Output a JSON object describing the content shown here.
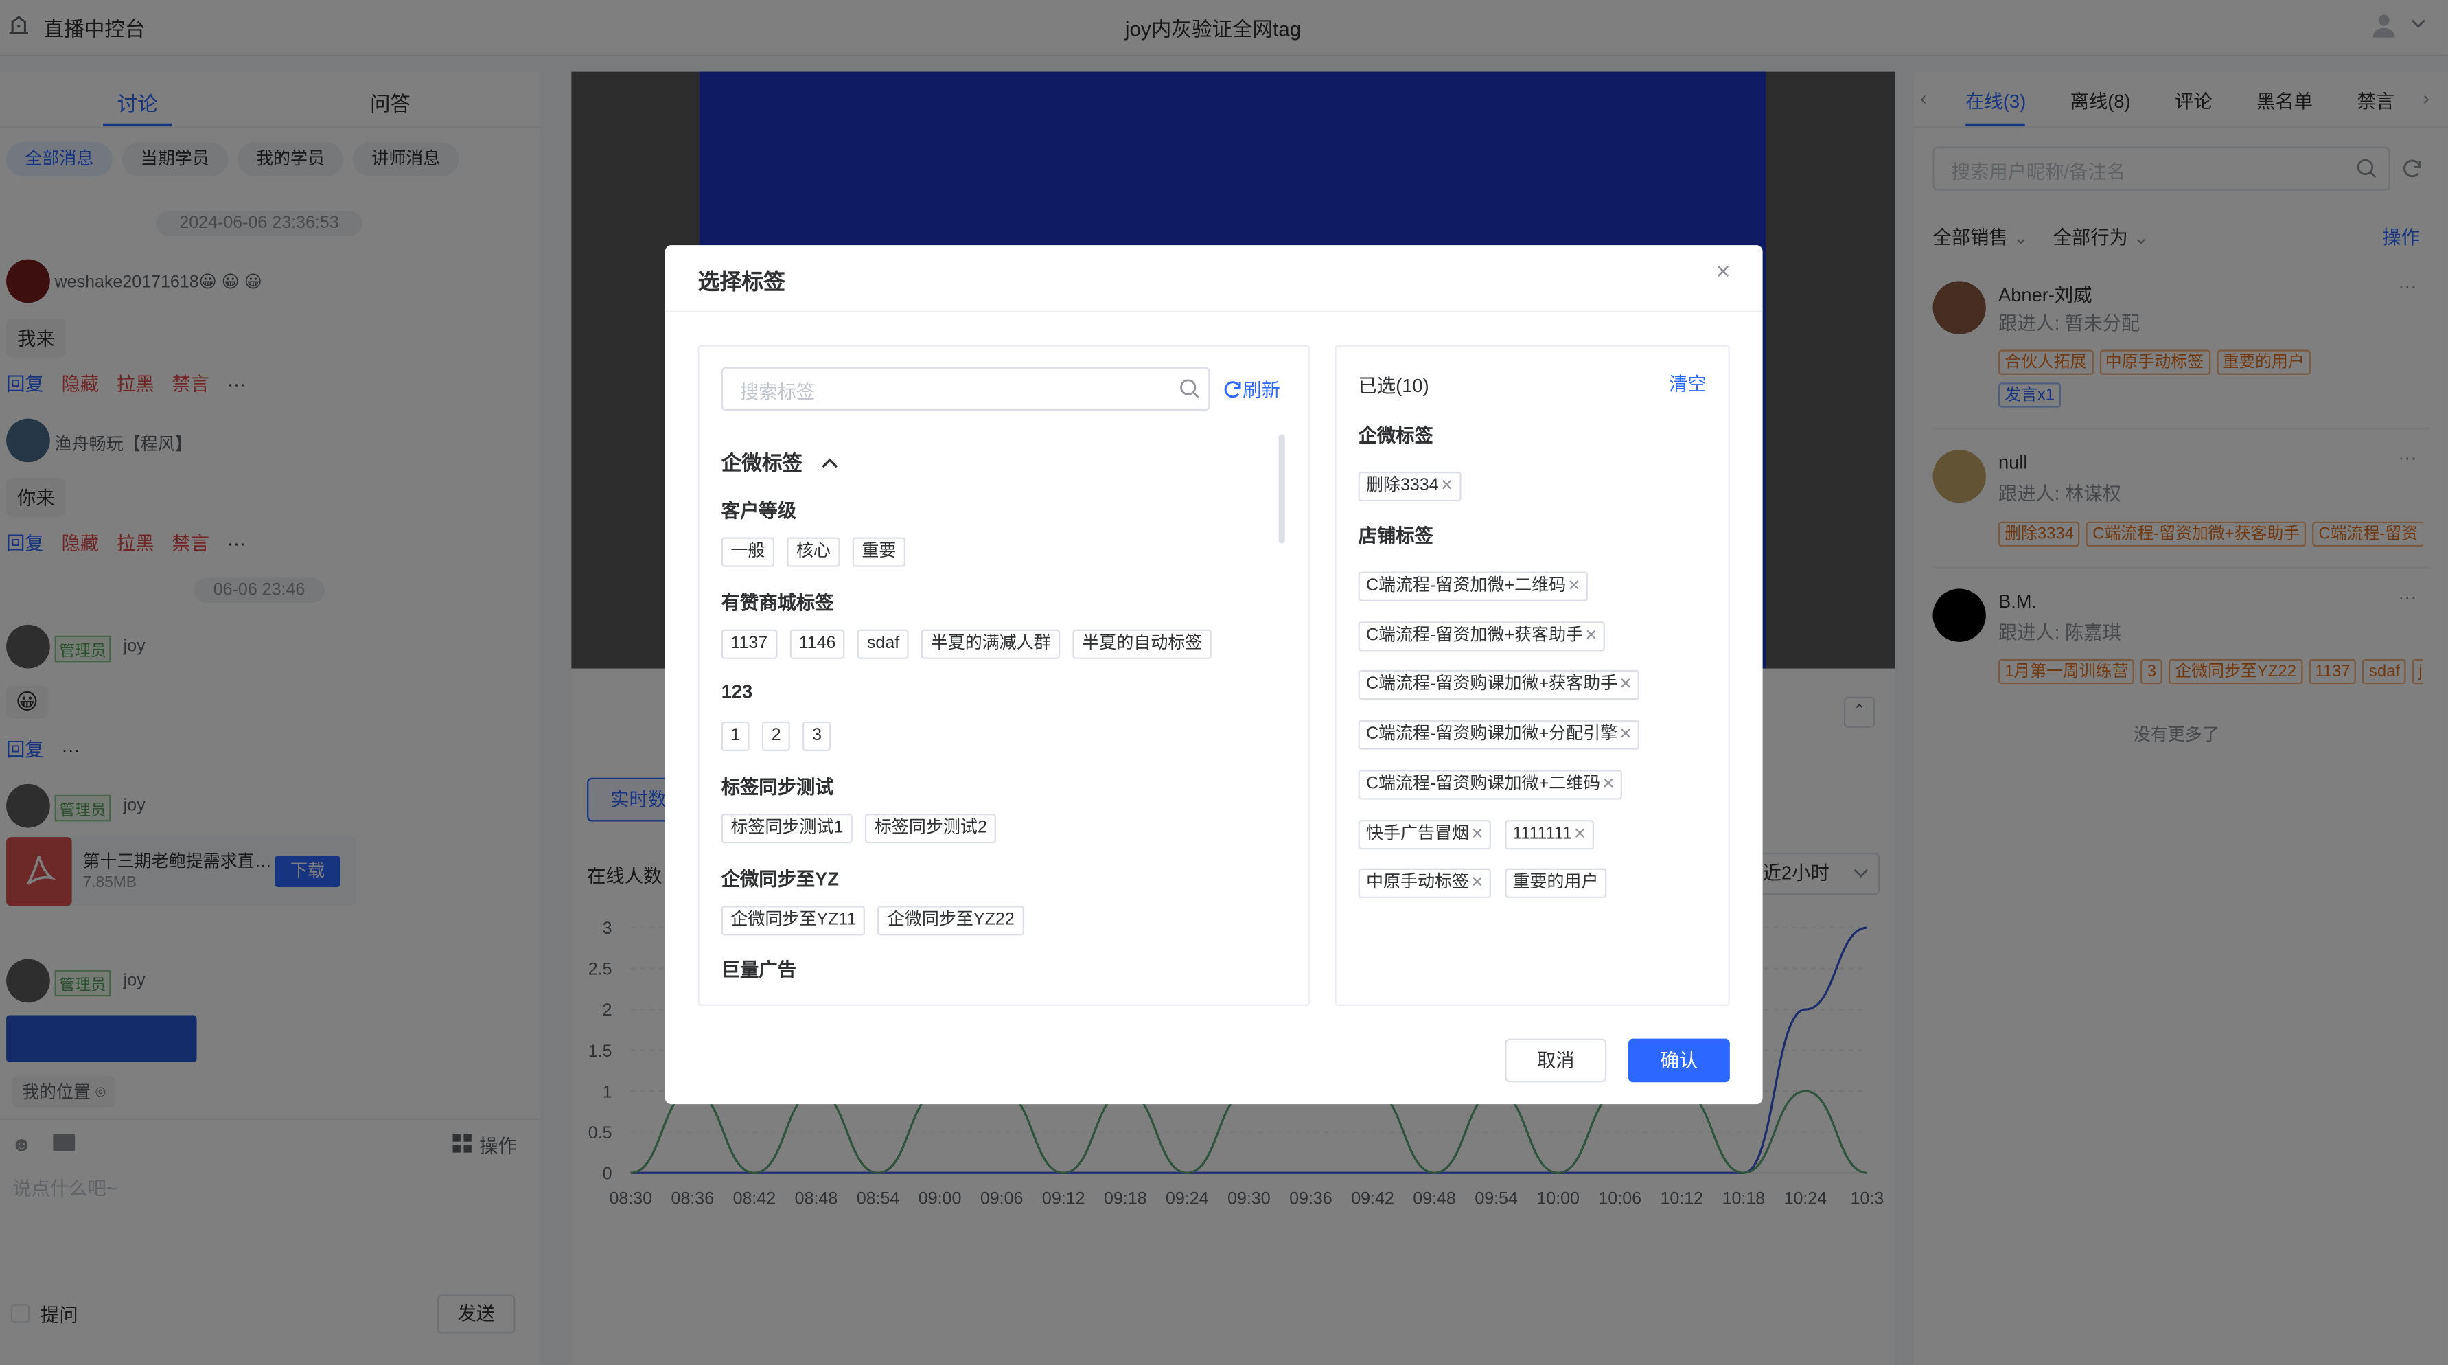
{
  "app": {
    "title": "直播中控台",
    "live_title": "joy内灰验证全网tag"
  },
  "left": {
    "tabs": [
      "讨论",
      "问答"
    ],
    "filters": [
      "全部消息",
      "当期学员",
      "我的学员",
      "讲师消息"
    ],
    "date1": "2024-06-06 23:36:53",
    "msg1": {
      "user": "weshake20171618😀 😀 😀",
      "text": "我来"
    },
    "actions": [
      "回复",
      "隐藏",
      "拉黑",
      "禁言"
    ],
    "more": "···",
    "msg2": {
      "user": "渔舟畅玩【程风】",
      "text": "你来"
    },
    "date2": "06-06 23:46",
    "admin_badge": "管理员",
    "admin_name": "joy",
    "emoji": "😀",
    "file": {
      "name": "第十三期老鲍提需求直…",
      "size": "7.85MB",
      "button": "下载"
    },
    "location": "我的位置",
    "operate": "操作",
    "input_placeholder": "说点什么吧~",
    "ask": "提问",
    "send": "发送"
  },
  "center": {
    "realtime": "实时数",
    "online_count_label": "在线人数",
    "range": "近2小时",
    "chart_data": {
      "type": "line",
      "x": [
        "08:30",
        "08:36",
        "08:42",
        "08:48",
        "08:54",
        "09:00",
        "09:06",
        "09:12",
        "09:18",
        "09:24",
        "09:30",
        "09:36",
        "09:42",
        "09:48",
        "09:54",
        "10:00",
        "10:06",
        "10:12",
        "10:18",
        "10:24",
        "10:3"
      ],
      "ylim": [
        0,
        3
      ],
      "yticks": [
        "0",
        "0.5",
        "1",
        "1.5",
        "2",
        "2.5",
        "3"
      ],
      "series": [
        {
          "color": "#3a5bd9",
          "values": [
            0,
            0,
            0,
            0,
            0,
            0,
            0,
            0,
            0,
            0,
            0,
            0,
            0,
            0,
            0,
            0,
            0,
            0,
            0,
            2,
            3
          ]
        },
        {
          "color": "#5fa777",
          "values": [
            0,
            1,
            0,
            1,
            0,
            1,
            1,
            0,
            1,
            0,
            1,
            1,
            1,
            0,
            1,
            0,
            1,
            1,
            0,
            1,
            0
          ]
        }
      ]
    }
  },
  "right": {
    "tabs": [
      "在线(3)",
      "离线(8)",
      "评论",
      "黑名单",
      "禁言"
    ],
    "search_placeholder": "搜索用户昵称/备注名",
    "filter_sales": "全部销售",
    "filter_action": "全部行为",
    "operate": "操作",
    "users": [
      {
        "name": "Abner-刘威",
        "follow": "跟进人: 暂未分配",
        "tags": [
          "合伙人拓展",
          "中原手动标签",
          "重要的用户"
        ],
        "extra": "发言x1"
      },
      {
        "name": "null",
        "follow": "跟进人: 林谋权",
        "tags": [
          "删除3334",
          "C端流程-留资加微+获客助手",
          "C端流程-留资"
        ]
      },
      {
        "name": "B.M.",
        "follow": "跟进人: 陈嘉琪",
        "tags": [
          "1月第一周训练营",
          "3",
          "企微同步至YZ22",
          "1137",
          "sdaf",
          "j"
        ]
      }
    ],
    "no_more": "没有更多了"
  },
  "modal": {
    "title": "选择标签",
    "search_placeholder": "搜索标签",
    "refresh": "刷新",
    "group_title": "企微标签",
    "groups": [
      {
        "name": "客户等级",
        "tags": [
          "一般",
          "核心",
          "重要"
        ]
      },
      {
        "name": "有赞商城标签",
        "tags": [
          "1137",
          "1146",
          "sdaf",
          "半夏的满减人群",
          "半夏的自动标签"
        ]
      },
      {
        "name": "123",
        "tags": [
          "1",
          "2",
          "3"
        ]
      },
      {
        "name": "标签同步测试",
        "tags": [
          "标签同步测试1",
          "标签同步测试2"
        ]
      },
      {
        "name": "企微同步至YZ",
        "tags": [
          "企微同步至YZ11",
          "企微同步至YZ22"
        ]
      },
      {
        "name": "巨量广告",
        "tags": []
      }
    ],
    "selected_label": "已选(10)",
    "clear": "清空",
    "sel_group1": "企微标签",
    "sel_tags1": [
      "删除3334"
    ],
    "sel_group2": "店铺标签",
    "sel_tags2": [
      "C端流程-留资加微+二维码",
      "C端流程-留资加微+获客助手",
      "C端流程-留资购课加微+获客助手",
      "C端流程-留资购课加微+分配引擎",
      "C端流程-留资购课加微+二维码"
    ],
    "sel_row_a": [
      "快手广告冒烟",
      "1111111"
    ],
    "sel_row_b": [
      "中原手动标签",
      "重要的用户"
    ],
    "cancel": "取消",
    "confirm": "确认"
  }
}
